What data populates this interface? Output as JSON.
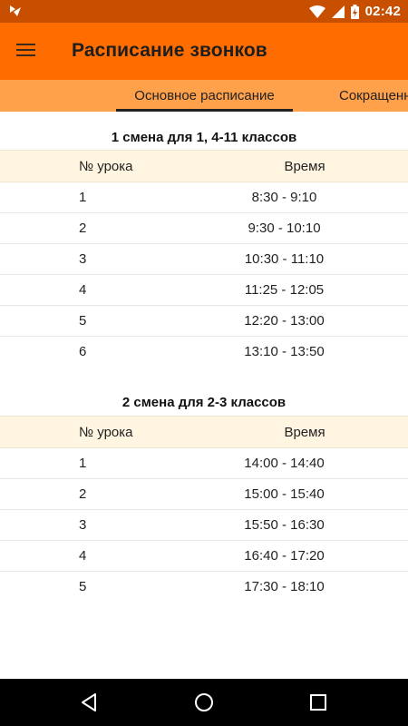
{
  "status_bar": {
    "time": "02:42",
    "icons": [
      "notification-app-icon",
      "wifi-icon",
      "signal-icon",
      "battery-charging-icon"
    ]
  },
  "app_bar": {
    "title": "Расписание звонков",
    "menu_icon": "hamburger-menu-icon"
  },
  "tabs": [
    {
      "label": "Основное расписание",
      "selected": true
    },
    {
      "label": "Сокращенн",
      "selected": false
    }
  ],
  "sections": [
    {
      "title": "1 смена для 1, 4-11 классов",
      "columns": [
        "№ урока",
        "Время"
      ],
      "rows": [
        [
          "1",
          "8:30 - 9:10"
        ],
        [
          "2",
          "9:30 - 10:10"
        ],
        [
          "3",
          "10:30 - 11:10"
        ],
        [
          "4",
          "11:25 - 12:05"
        ],
        [
          "5",
          "12:20 - 13:00"
        ],
        [
          "6",
          "13:10 - 13:50"
        ]
      ]
    },
    {
      "title": "2 смена для 2-3 классов",
      "columns": [
        "№ урока",
        "Время"
      ],
      "rows": [
        [
          "1",
          "14:00 - 14:40"
        ],
        [
          "2",
          "15:00 - 15:40"
        ],
        [
          "3",
          "15:50 - 16:30"
        ],
        [
          "4",
          "16:40 - 17:20"
        ],
        [
          "5",
          "17:30 - 18:10"
        ]
      ]
    }
  ],
  "colors": {
    "status_bar": "#c84e00",
    "app_bar": "#ff6d00",
    "tab_bar": "#ffa04a",
    "header_row": "#fff5e1"
  },
  "nav_bar": {
    "icons": [
      "back-icon",
      "home-icon",
      "recents-icon"
    ]
  }
}
